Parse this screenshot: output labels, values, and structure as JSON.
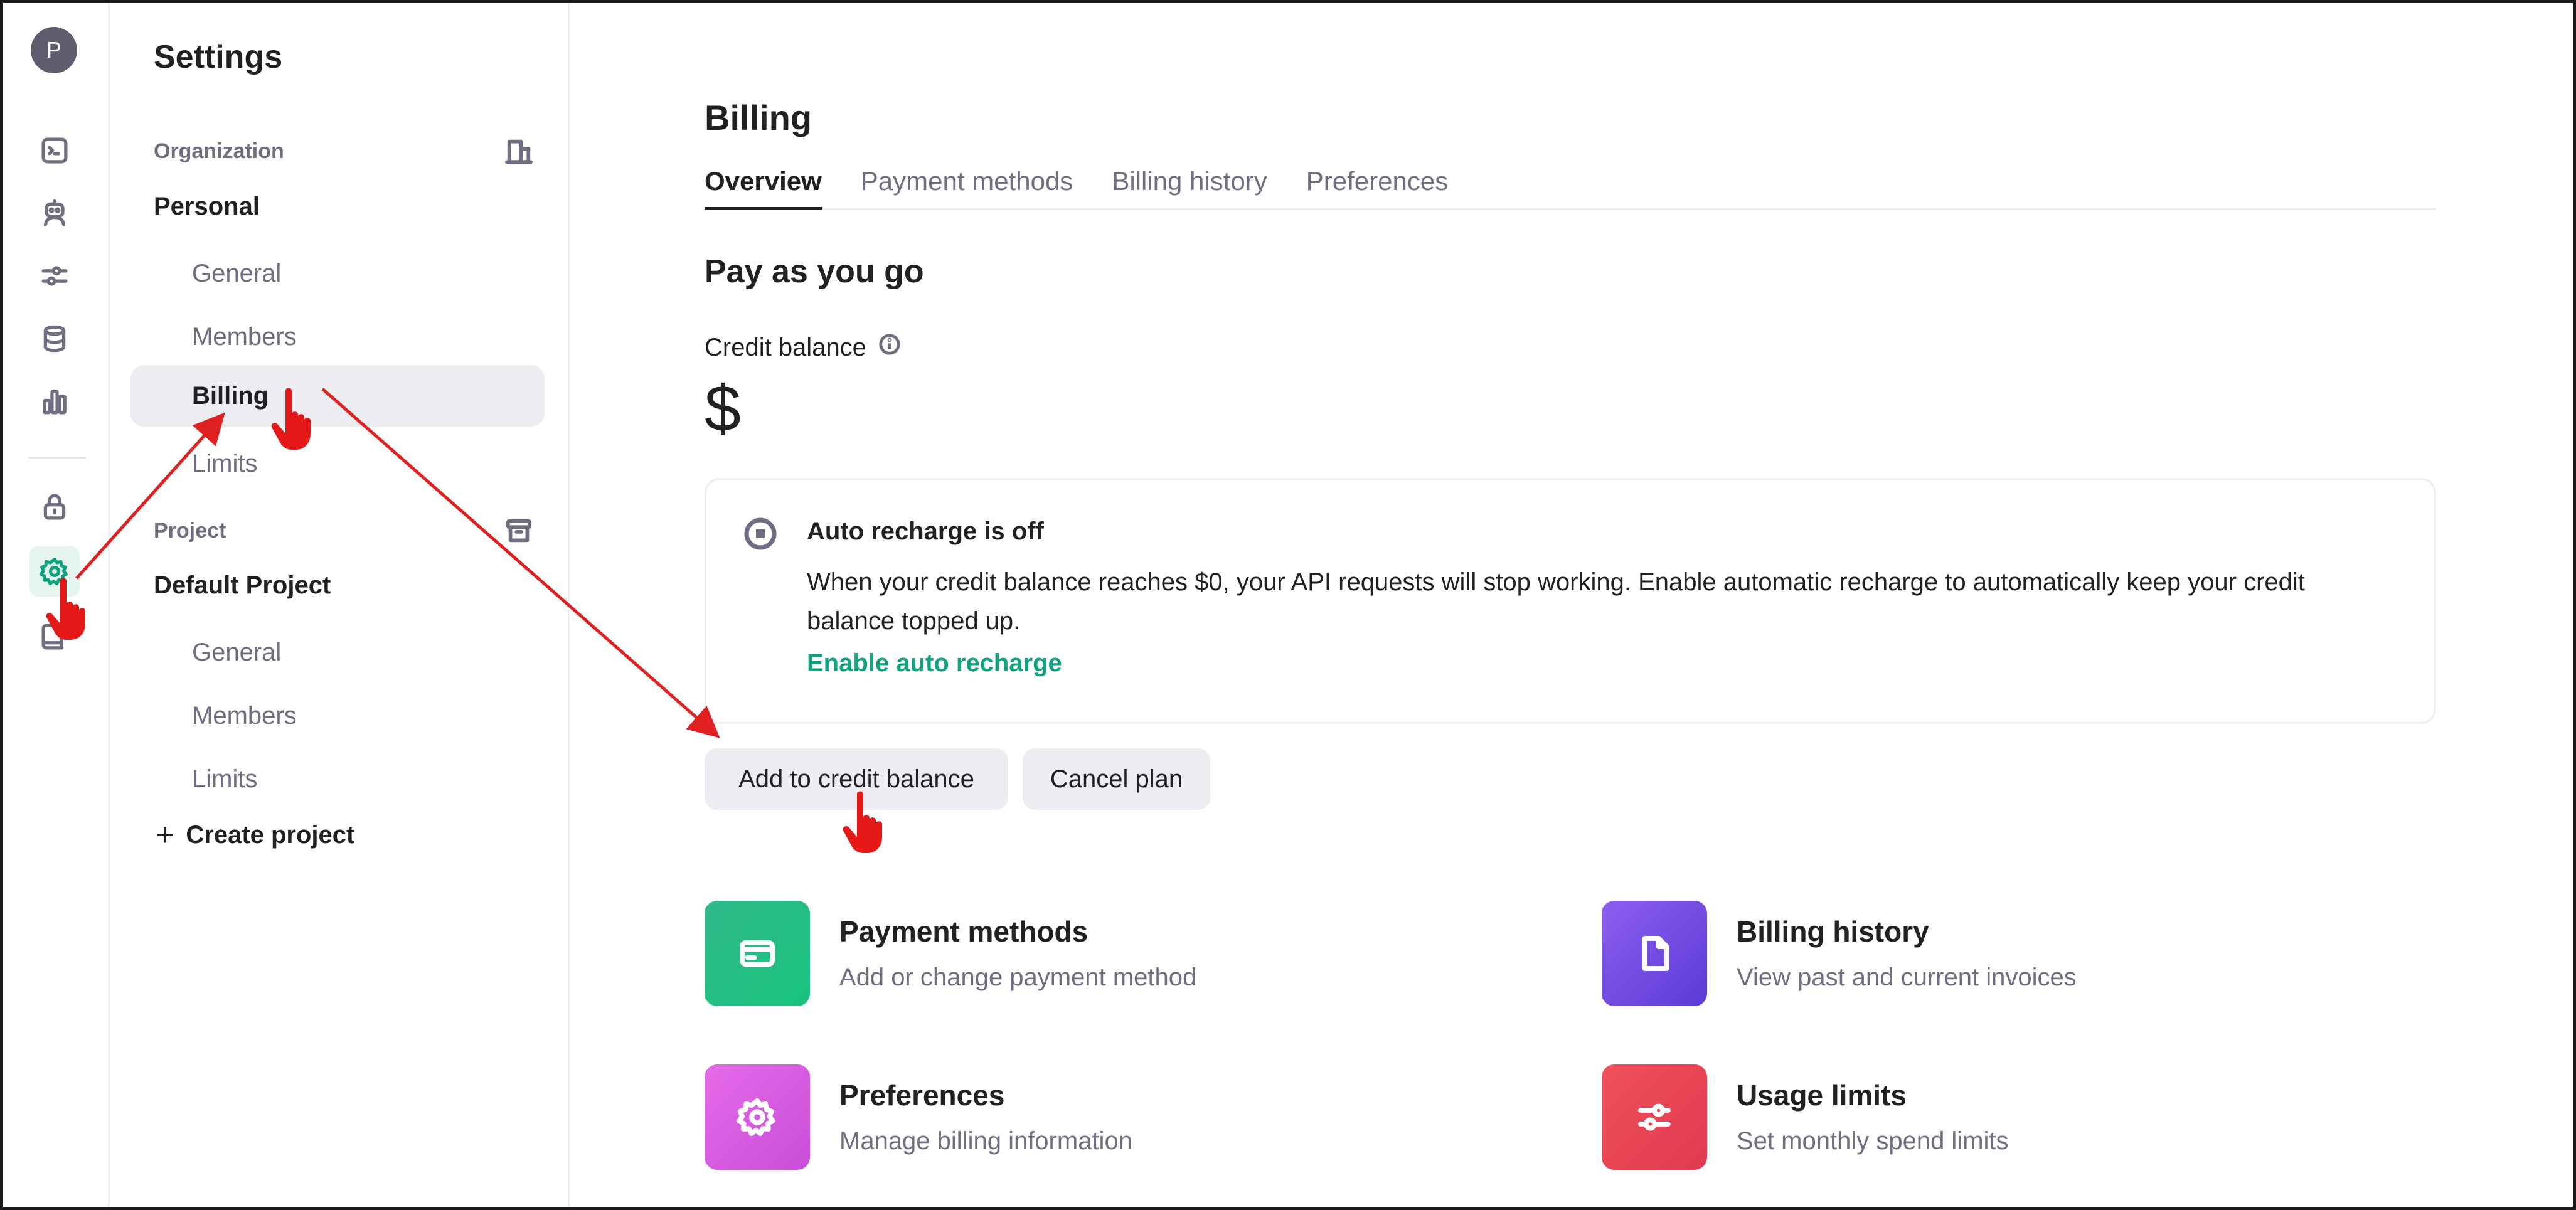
{
  "rail": {
    "avatar_initial": "P",
    "icons": [
      "terminal-icon",
      "robot-icon",
      "sliders-icon",
      "database-icon",
      "bar-chart-icon",
      "lock-icon",
      "gear-icon",
      "book-icon"
    ],
    "active_icon": "gear-icon",
    "accent_color": "#10a37f"
  },
  "sidebar": {
    "title": "Settings",
    "organization_label": "Organization",
    "organization_name": "Personal",
    "org_items": [
      {
        "label": "General"
      },
      {
        "label": "Members"
      },
      {
        "label": "Billing"
      },
      {
        "label": "Limits"
      }
    ],
    "project_label": "Project",
    "project_name": "Default Project",
    "project_items": [
      {
        "label": "General"
      },
      {
        "label": "Members"
      },
      {
        "label": "Limits"
      }
    ],
    "create_project_label": "Create project"
  },
  "main": {
    "title": "Billing",
    "tabs": [
      {
        "label": "Overview"
      },
      {
        "label": "Payment methods"
      },
      {
        "label": "Billing history"
      },
      {
        "label": "Preferences"
      }
    ],
    "section_title": "Pay as you go",
    "credit_label": "Credit balance",
    "credit_value": "$",
    "notice": {
      "title": "Auto recharge is off",
      "body": "When your credit balance reaches $0, your API requests will stop working. Enable automatic recharge to automatically keep your credit balance topped up.",
      "link": "Enable auto recharge"
    },
    "buttons": {
      "add_credit": "Add to credit balance",
      "cancel_plan": "Cancel plan"
    },
    "cards": [
      {
        "title": "Payment methods",
        "desc": "Add or change payment method",
        "color": "#19c37d",
        "icon": "credit-card-icon"
      },
      {
        "title": "Billing history",
        "desc": "View past and current invoices",
        "color": "#715fde",
        "icon": "document-icon"
      },
      {
        "title": "Preferences",
        "desc": "Manage billing information",
        "color": "#dd5ce5",
        "icon": "gear-icon"
      },
      {
        "title": "Usage limits",
        "desc": "Set monthly spend limits",
        "color": "#ef4146",
        "icon": "sliders-icon"
      }
    ]
  },
  "annotation_color": "#e02020"
}
